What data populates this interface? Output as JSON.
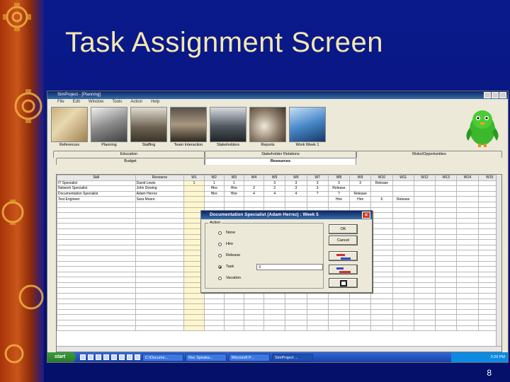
{
  "slide": {
    "title": "Task Assignment Screen",
    "number": "8"
  },
  "window": {
    "title": "SimProject - [Planning]",
    "menu": [
      "File",
      "Edit",
      "Window",
      "Tools",
      "Action",
      "Help"
    ]
  },
  "toolbar": {
    "buttons": [
      "References",
      "Planning",
      "Staffing",
      "Team Interaction",
      "Stakeholders",
      "Reports",
      "Work Week 1"
    ]
  },
  "tabs": {
    "row1": [
      "Education",
      "Stakeholder Relations",
      "Risks/Opportunities"
    ],
    "row2": [
      "Budget",
      "Resources"
    ]
  },
  "grid": {
    "headers": [
      "Skill",
      "Resource",
      "W1",
      "W2",
      "W3",
      "W4",
      "W5",
      "W6",
      "W7",
      "W8",
      "W9",
      "W10",
      "W11",
      "W12",
      "W13",
      "W14",
      "W15"
    ],
    "rows": [
      [
        "IT Specialist",
        "David Lewis",
        "1",
        "1",
        "1",
        "",
        "3",
        "3",
        "3",
        "3",
        "3",
        "Release",
        "",
        "",
        "",
        "",
        ""
      ],
      [
        "Network Specialist",
        "John Dewing",
        "",
        "Hire",
        "Hire",
        "2",
        "2",
        "3",
        "3",
        "Release",
        "",
        "",
        "",
        "",
        "",
        "",
        ""
      ],
      [
        "Documentation Specialist",
        "Adam Herrez",
        "",
        "Hire",
        "Hire",
        "4",
        "4",
        "4",
        "?",
        "?",
        "Release",
        "",
        "",
        "",
        "",
        "",
        ""
      ],
      [
        "Test Engineer",
        "Sara Moore",
        "",
        "",
        "",
        "",
        "",
        "",
        "",
        "Hire",
        "Hire",
        "6",
        "Release",
        "",
        "",
        "",
        ""
      ]
    ],
    "empty_rows": 24
  },
  "dialog": {
    "title": "Documentation Specialist  (Adam Herrez) : Week 5",
    "group_label": "Action",
    "options": [
      "None",
      "Hire",
      "Release",
      "Task",
      "Vacation"
    ],
    "selected": "Task",
    "task_value": "3",
    "ok_label": "OK",
    "cancel_label": "Cancel"
  },
  "taskbar": {
    "start_label": "start",
    "items": [
      "C:\\Docume...",
      "Rec Speaka...",
      "Microsoft P...",
      "SimProject ..."
    ],
    "clock": "3:29 PM"
  },
  "colors": {
    "slide_bg": "#0a1a8c",
    "title_color": "#f5e7b0",
    "win_title": "#0a246a",
    "w1_highlight": "#fff7cc"
  }
}
